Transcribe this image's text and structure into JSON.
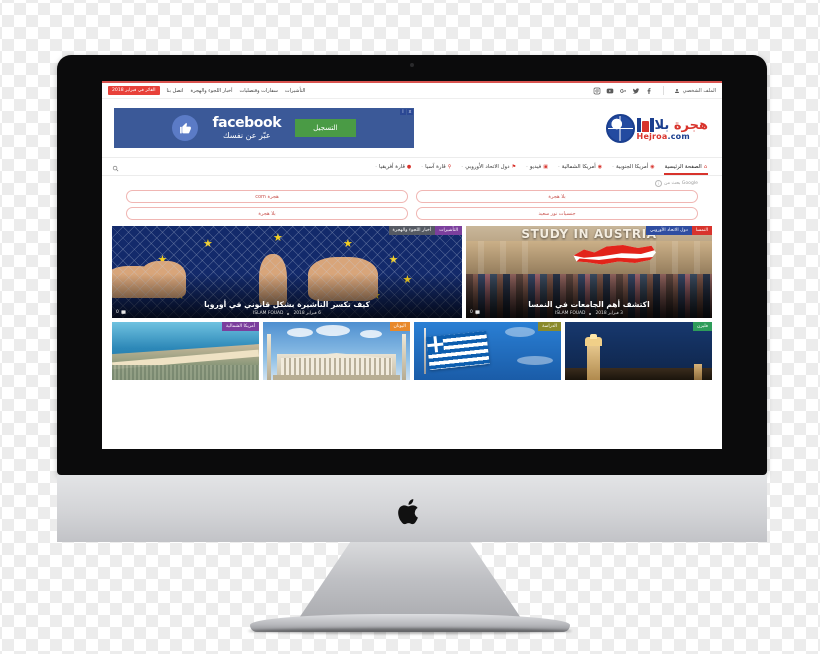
{
  "topbar": {
    "social_icons": [
      "instagram-icon",
      "youtube-icon",
      "google-plus-icon",
      "twitter-icon",
      "facebook-icon"
    ],
    "profile_label": "الملف الشخصي",
    "nav_items": [
      {
        "label": "التأشيرات"
      },
      {
        "label": "سفارات وقنصليات"
      },
      {
        "label": "أخبار اللجوء والهجرة"
      },
      {
        "label": "اتصل بنا"
      }
    ],
    "badge": "الفائز في فبراير 2018"
  },
  "logo": {
    "arabic_blue": "بلا",
    "arabic_red": "هجرة",
    "latin": "Hejroa",
    "domain": ".com"
  },
  "ad": {
    "brand": "facebook",
    "tagline": "عبّر عن نفسك",
    "cta": "التسجيل",
    "close_marks": [
      "i",
      "x"
    ]
  },
  "mainnav": {
    "items": [
      {
        "label": "الصفحة الرئيسية",
        "icon": "home-icon",
        "active": true
      },
      {
        "label": "أمريكا الجنوبية",
        "icon": "globe-icon",
        "active": false
      },
      {
        "label": "أمريكا الشمالية",
        "icon": "globe-icon",
        "active": false
      },
      {
        "label": "فيديو",
        "icon": "video-icon",
        "active": false
      },
      {
        "label": "دول الاتحاد الأوروبي",
        "icon": "flag-icon",
        "active": false
      },
      {
        "label": "قارة آسيا",
        "icon": "pin-icon",
        "active": false
      },
      {
        "label": "قارة أفريقيا",
        "icon": "circle-icon",
        "active": false
      }
    ],
    "separator": "-",
    "search_icon": "search-icon"
  },
  "adsense": {
    "label": "بحث من Google",
    "info_icon": "info-icon",
    "buttons": [
      "بلا هجرة",
      "هجرة com",
      "جنسيات نور سعيد",
      "بلا هجرة"
    ]
  },
  "cards": {
    "featured": [
      {
        "title": "اكتشف أهم الجامعات في النمسا",
        "author": "ISLAM FOUAD",
        "date": "3 فبراير 2018",
        "comments": "0",
        "comments_icon": "comment-icon",
        "tags": [
          {
            "label": "النمسا",
            "color": "red"
          },
          {
            "label": "دول الاتحاد الأوروبي",
            "color": "blue"
          }
        ],
        "artwork_caption": "STUDY IN AUSTRIA"
      },
      {
        "title": "كيف تكسر التأشيرة بشكل قانوني في أوروبا",
        "author": "ISLAM FOUAD",
        "date": "6 فبراير 2018",
        "comments": "0",
        "comments_icon": "comment-icon",
        "tags": [
          {
            "label": "التأشيرات",
            "color": "purple"
          },
          {
            "label": "أخبار اللجوء والهجرة",
            "color": "gray"
          }
        ],
        "artwork_caption": ""
      }
    ],
    "secondary": [
      {
        "tag": "فليزن",
        "color": "green"
      },
      {
        "tag": "الدراسة",
        "color": "olive"
      },
      {
        "tag": "اليونان",
        "color": "orange"
      },
      {
        "tag": "أمريكا الشمالية",
        "color": "violet"
      }
    ]
  },
  "device": {
    "brand_mark": "apple-logo",
    "camera": "webcam-dot"
  },
  "colors": {
    "accent_red": "#d8332c",
    "facebook_blue": "#3b5998",
    "cta_green": "#4a9b45",
    "logo_blue": "#1b3f8f"
  }
}
